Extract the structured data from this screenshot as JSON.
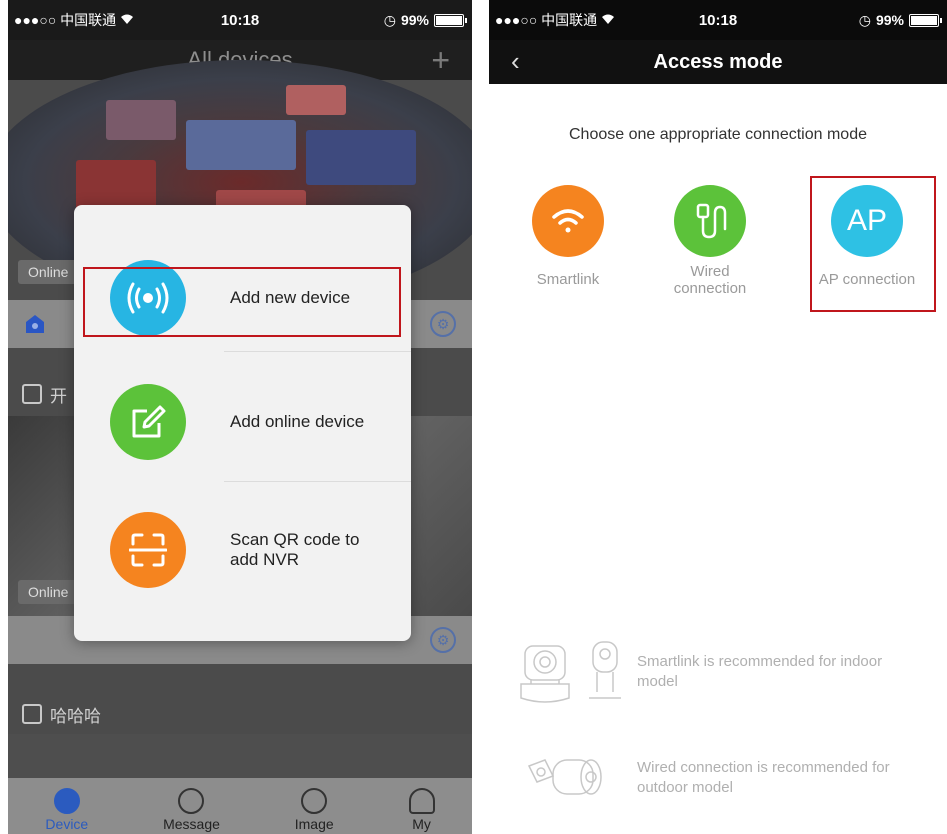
{
  "left_screen": {
    "status": {
      "carrier": "●●●○○ 中国联通",
      "time": "10:18",
      "battery": "99%"
    },
    "title": "All devices",
    "add_glyph": "+",
    "feed_tags": [
      "Online",
      "Online"
    ],
    "camera_names": [
      "开",
      "哈哈哈"
    ],
    "popup": {
      "items": [
        {
          "label": "Add new device",
          "icon": "broadcast-icon",
          "color": "#27b5e3"
        },
        {
          "label": "Add online device",
          "icon": "edit-square-icon",
          "color": "#5cc23a"
        },
        {
          "label": "Scan QR code to add NVR",
          "icon": "scan-icon",
          "color": "#f5841f"
        }
      ]
    },
    "tabs": [
      {
        "label": "Device",
        "icon": "camera-icon",
        "active": true
      },
      {
        "label": "Message",
        "icon": "chat-bubble-icon",
        "active": false
      },
      {
        "label": "Image",
        "icon": "image-icon",
        "active": false
      },
      {
        "label": "My",
        "icon": "person-icon",
        "active": false
      }
    ]
  },
  "right_screen": {
    "status": {
      "carrier": "●●●○○ 中国联通",
      "time": "10:18",
      "battery": "99%"
    },
    "back_glyph": "‹",
    "title": "Access mode",
    "prompt": "Choose one appropriate connection mode",
    "modes": [
      {
        "label": "Smartlink",
        "icon": "wifi-icon",
        "color": "#f5841f"
      },
      {
        "label": "Wired connection",
        "icon": "cable-plug-icon",
        "color": "#5cc23a"
      },
      {
        "label": "AP connection",
        "glyph": "AP",
        "color": "#2ec1e4"
      }
    ],
    "recommendations": [
      {
        "text": "Smartlink is recommended for indoor model",
        "icon": "indoor-camera-icon"
      },
      {
        "text": "Wired connection is recommended for outdoor model",
        "icon": "outdoor-camera-icon"
      }
    ]
  },
  "highlight_color": "#c0161c"
}
